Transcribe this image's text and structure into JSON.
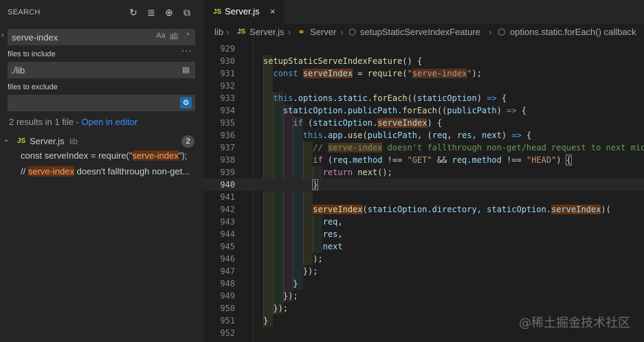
{
  "sidebar": {
    "title": "SEARCH",
    "actions": [
      {
        "name": "refresh-icon",
        "glyph": "↻"
      },
      {
        "name": "clear-results-icon",
        "glyph": "≣"
      },
      {
        "name": "new-search-editor-icon",
        "glyph": "⊕"
      },
      {
        "name": "collapse-all-icon",
        "glyph": "⧉"
      }
    ],
    "search_value": "serve-index",
    "options": {
      "match_case": "Aa",
      "whole_word": "ab",
      "regex": ".*"
    },
    "include_label": "files to include",
    "include_value": "./lib",
    "exclude_label": "files to exclude",
    "exclude_value": "",
    "summary": "2 results in 1 file - ",
    "open_in_editor": "Open in editor",
    "file": {
      "icon": "JS",
      "name": "Server.js",
      "dir": "lib",
      "count": "2"
    },
    "matches": [
      {
        "before": "const serveIndex = require(\"",
        "hit": "serve-index",
        "after": "\");"
      },
      {
        "before": "// ",
        "hit": "serve-index",
        "after": " doesn't fallthrough non-get..."
      }
    ]
  },
  "tab": {
    "icon": "JS",
    "name": "Server.js",
    "close": "×"
  },
  "breadcrumb": {
    "folder": "lib",
    "file": "Server.js",
    "class": "Server",
    "method": "setupStaticServeIndexFeature",
    "callback": "options.static.forEach() callback"
  },
  "watermark": "@稀土掘金技术社区",
  "code": {
    "current_line": "940",
    "lines": [
      {
        "n": "929",
        "html": ""
      },
      {
        "n": "930",
        "html": "<span class=\"f\">setupStaticServeIndexFeature</span><span class=\"p\">() {</span>"
      },
      {
        "n": "931",
        "html": "  <span class=\"k\">const</span> <span class=\"v sm\">serveIndex</span> <span class=\"p\">=</span> <span class=\"f\">require</span><span class=\"p\">(</span><span class=\"s\">\"<span class=\"cmh\">serve-index</span>\"</span><span class=\"p\">);</span>"
      },
      {
        "n": "932",
        "html": ""
      },
      {
        "n": "933",
        "html": "  <span class=\"k\">this</span><span class=\"p\">.</span><span class=\"v\">options</span><span class=\"p\">.</span><span class=\"v\">static</span><span class=\"p\">.</span><span class=\"f\">forEach</span><span class=\"p\">((</span><span class=\"v\">staticOption</span><span class=\"p\">) </span><span class=\"k\">=&gt;</span><span class=\"p\"> {</span>"
      },
      {
        "n": "934",
        "html": "    <span class=\"v\">staticOption</span><span class=\"p\">.</span><span class=\"v\">publicPath</span><span class=\"p\">.</span><span class=\"f\">forEach</span><span class=\"p\">((</span><span class=\"v\">publicPath</span><span class=\"p\">) </span><span class=\"k\">=&gt;</span><span class=\"p\"> {</span>"
      },
      {
        "n": "935",
        "html": "      <span class=\"kc\">if</span><span class=\"p\"> (</span><span class=\"v\">staticOption</span><span class=\"p\">.</span><span class=\"v sm\">serveIndex</span><span class=\"p\">) {</span>"
      },
      {
        "n": "936",
        "html": "        <span class=\"k\">this</span><span class=\"p\">.</span><span class=\"v\">app</span><span class=\"p\">.</span><span class=\"f\">use</span><span class=\"p\">(</span><span class=\"v\">publicPath</span><span class=\"p\">, (</span><span class=\"v\">req</span><span class=\"p\">, </span><span class=\"v\">res</span><span class=\"p\">, </span><span class=\"v\">next</span><span class=\"p\">) </span><span class=\"k\">=&gt;</span><span class=\"p\"> {</span>"
      },
      {
        "n": "937",
        "html": "          <span class=\"c\">// <span class=\"cmh\">serve-index</span> doesn't fallthrough non-get/head request to next mid</span>"
      },
      {
        "n": "938",
        "html": "          <span class=\"kc\">if</span><span class=\"p\"> (</span><span class=\"v\">req</span><span class=\"p\">.</span><span class=\"v\">method</span><span class=\"p\"> !== </span><span class=\"s\">\"GET\"</span><span class=\"p\"> &amp;&amp; </span><span class=\"v\">req</span><span class=\"p\">.</span><span class=\"v\">method</span><span class=\"p\"> !== </span><span class=\"s\">\"HEAD\"</span><span class=\"p\">) </span><span class=\"p brk\">{</span>"
      },
      {
        "n": "939",
        "html": "            <span class=\"kc\">return</span> <span class=\"f\">next</span><span class=\"p\">();</span>"
      },
      {
        "n": "940",
        "html": "          <span class=\"p brk\">}</span>"
      },
      {
        "n": "941",
        "html": ""
      },
      {
        "n": "942",
        "html": "          <span class=\"f sm\">serveIndex</span><span class=\"p\">(</span><span class=\"v\">staticOption</span><span class=\"p\">.</span><span class=\"v\">directory</span><span class=\"p\">, </span><span class=\"v\">staticOption</span><span class=\"p\">.</span><span class=\"v sm\">serveIndex</span><span class=\"p\">)(</span>"
      },
      {
        "n": "943",
        "html": "            <span class=\"v\">req</span><span class=\"p\">,</span>"
      },
      {
        "n": "944",
        "html": "            <span class=\"v\">res</span><span class=\"p\">,</span>"
      },
      {
        "n": "945",
        "html": "            <span class=\"v\">next</span>"
      },
      {
        "n": "946",
        "html": "          <span class=\"p\">);</span>"
      },
      {
        "n": "947",
        "html": "        <span class=\"p\">});</span>"
      },
      {
        "n": "948",
        "html": "      <span class=\"p\">}</span>"
      },
      {
        "n": "949",
        "html": "    <span class=\"p\">});</span>"
      },
      {
        "n": "950",
        "html": "  <span class=\"p\">});</span>"
      },
      {
        "n": "951",
        "html": "<span class=\"p\">}</span>"
      },
      {
        "n": "952",
        "html": ""
      }
    ]
  }
}
